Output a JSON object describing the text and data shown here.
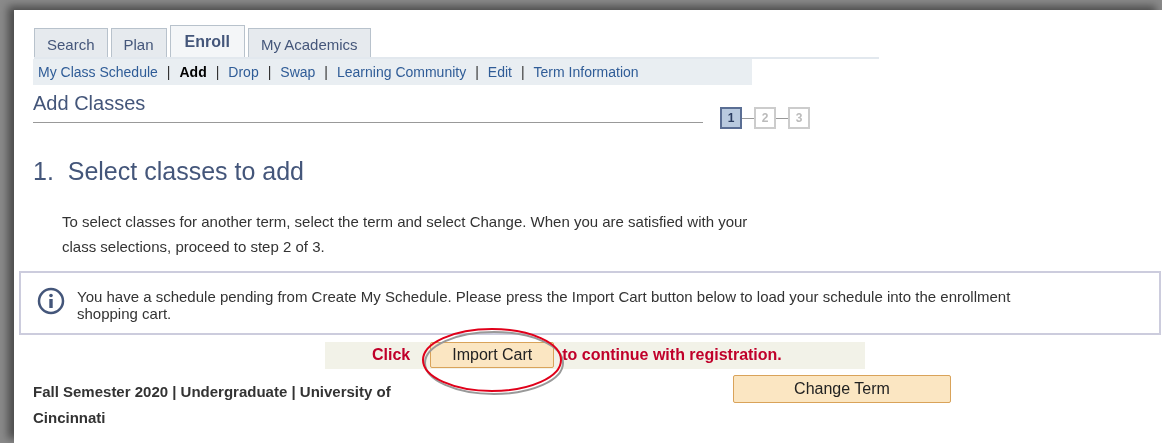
{
  "tabs": [
    {
      "label": "Search",
      "selected": false
    },
    {
      "label": "Plan",
      "selected": false
    },
    {
      "label": "Enroll",
      "selected": true
    },
    {
      "label": "My Academics",
      "selected": false
    }
  ],
  "subnav": [
    {
      "label": "My Class Schedule",
      "selected": false
    },
    {
      "separator": "|",
      "label": "Add",
      "selected": true
    },
    {
      "separator": "|",
      "label": "Drop",
      "selected": false
    },
    {
      "separator": "|",
      "label": "Swap",
      "selected": false
    },
    {
      "separator": "|",
      "label": "Learning Community",
      "selected": false
    },
    {
      "separator": "|",
      "label": "Edit",
      "selected": false
    },
    {
      "separator": "|",
      "label": "Term Information",
      "selected": false
    }
  ],
  "page_title": "Add Classes",
  "steps": [
    {
      "label": "1",
      "selected": true
    },
    {
      "label": "2",
      "selected": false
    },
    {
      "label": "3",
      "selected": false
    }
  ],
  "step_heading": "1.  Select classes to add",
  "instructions": "To select classes for another term, select the term and select Change.  When you are satisfied with your class selections, proceed to step 2 of 3.",
  "info_message": "You have a schedule pending from Create My Schedule. Please press the Import Cart button below to load your schedule into the enrollment shopping cart.",
  "import_bar": {
    "before": "Click",
    "button": "Import Cart",
    "after": "to continue with registration."
  },
  "term": "Fall Semester 2020 | Undergraduate | University of Cincinnati",
  "change_term_button": "Change Term"
}
